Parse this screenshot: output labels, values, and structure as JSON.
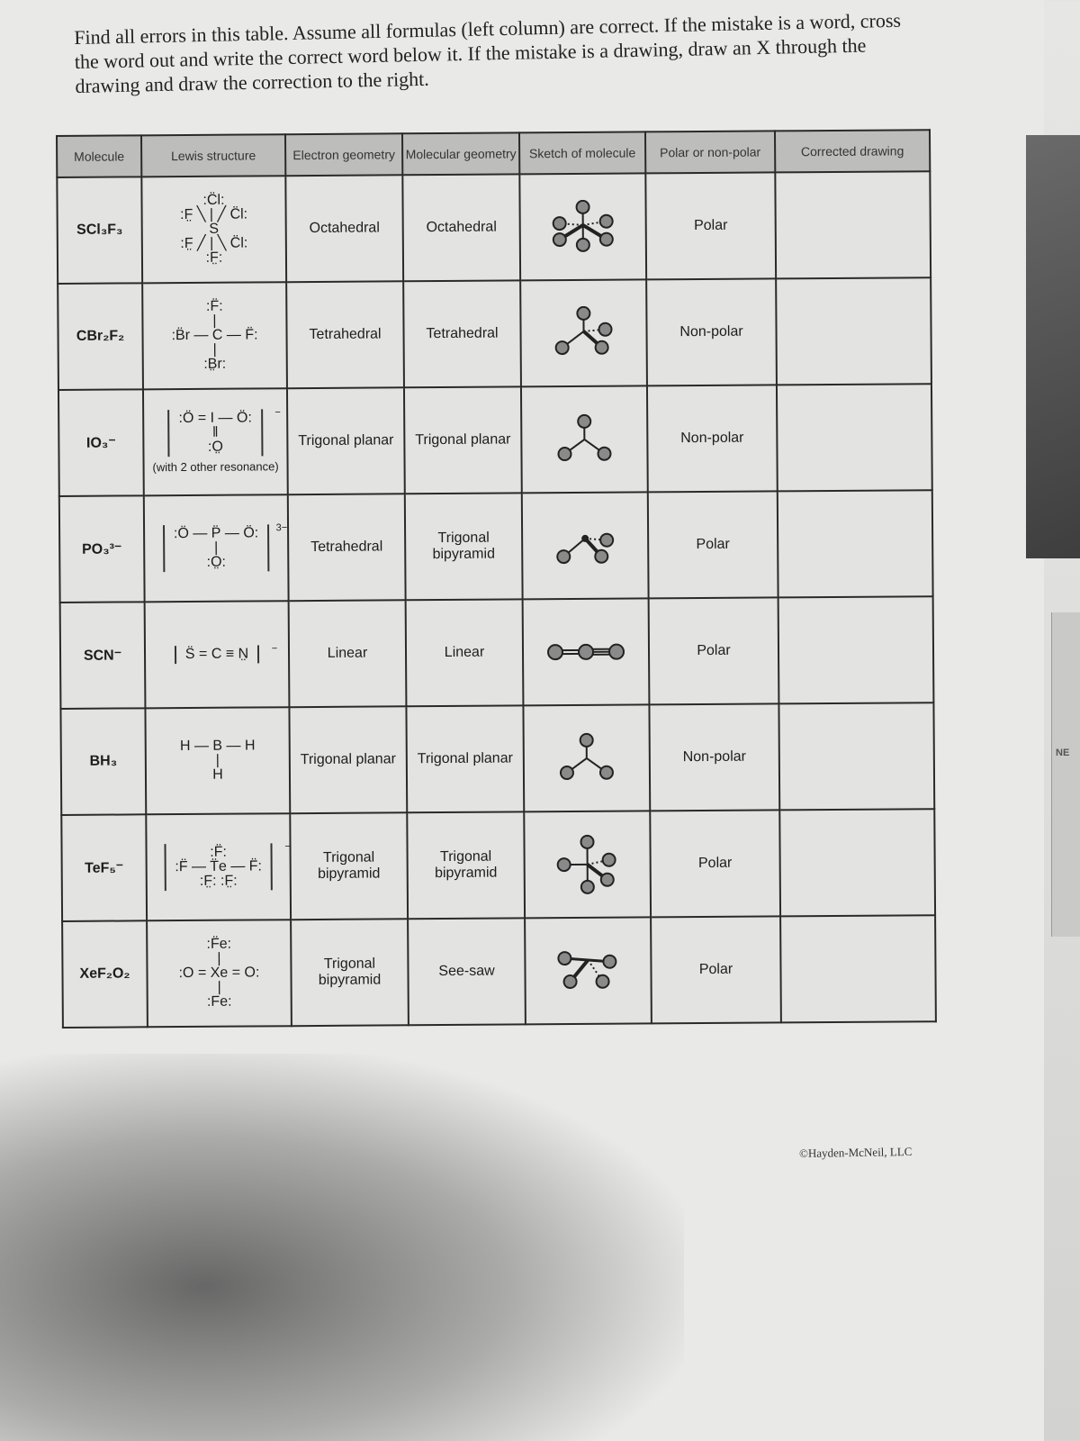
{
  "instructions": "Find all errors in this table. Assume all formulas (left column) are correct. If the mistake is a word, cross the word out and write the correct word below it. If the mistake is a drawing, draw an X through the drawing and draw the correction to the right.",
  "table": {
    "headers": [
      "Molecule",
      "Lewis structure",
      "Electron geometry",
      "Molecular geometry",
      "Sketch of molecule",
      "Polar or non-polar",
      "Corrected drawing"
    ],
    "rows": [
      {
        "molecule": "SCl₃F₃",
        "lewis": ":Cl: / :F—S—Cl: / :F—  —Cl: / :F:",
        "lewis_lines": [
          ":C̈l:",
          ":F̤ ╲ | ╱ C̈l:",
          "S",
          ":F̤ ╱ | ╲ C̈l:",
          ":F̤:"
        ],
        "lewis_note": "",
        "charge": "",
        "electron_geometry": "Octahedral",
        "molecular_geometry": "Octahedral",
        "sketch_icon": "octahedral-sketch-icon",
        "polarity": "Polar",
        "corrected": ""
      },
      {
        "molecule": "CBr₂F₂",
        "lewis_lines": [
          ":F̈:",
          "|",
          ":B̈r — C — F̈:",
          "|",
          ":B̤r:"
        ],
        "lewis_note": "",
        "charge": "",
        "electron_geometry": "Tetrahedral",
        "molecular_geometry": "Tetrahedral",
        "sketch_icon": "tetrahedral-sketch-icon",
        "polarity": "Non-polar",
        "corrected": ""
      },
      {
        "molecule": "IO₃⁻",
        "lewis_lines": [
          ":Ö = I — Ö:",
          "‖",
          ":O̤"
        ],
        "lewis_note": "(with 2 other resonance)",
        "charge": "−",
        "electron_geometry": "Trigonal planar",
        "molecular_geometry": "Trigonal planar",
        "sketch_icon": "trigonal-planar-sketch-icon",
        "polarity": "Non-polar",
        "corrected": ""
      },
      {
        "molecule": "PO₃³⁻",
        "lewis_lines": [
          ":Ö — P̈ — Ö:",
          "|",
          ":O̤:"
        ],
        "lewis_note": "",
        "charge": "3−",
        "electron_geometry": "Tetrahedral",
        "molecular_geometry": "Trigonal bipyramid",
        "sketch_icon": "trigonal-pyramidal-sketch-icon",
        "polarity": "Polar",
        "corrected": ""
      },
      {
        "molecule": "SCN⁻",
        "lewis_lines": [
          "S̈ = C ≡ N̤"
        ],
        "lewis_note": "",
        "charge": "−",
        "electron_geometry": "Linear",
        "molecular_geometry": "Linear",
        "sketch_icon": "linear-sketch-icon",
        "polarity": "Polar",
        "corrected": ""
      },
      {
        "molecule": "BH₃",
        "lewis_lines": [
          "H — B — H",
          "|",
          "H"
        ],
        "lewis_note": "",
        "charge": "",
        "electron_geometry": "Trigonal planar",
        "molecular_geometry": "Trigonal planar",
        "sketch_icon": "trigonal-planar-sketch-icon",
        "polarity": "Non-polar",
        "corrected": ""
      },
      {
        "molecule": "TeF₅⁻",
        "lewis_lines": [
          ":F̈:",
          ":F̈ — T̈e — F̈:",
          ":F̤: :F̤:"
        ],
        "lewis_note": "",
        "charge": "−",
        "electron_geometry": "Trigonal bipyramid",
        "molecular_geometry": "Trigonal bipyramid",
        "sketch_icon": "trigonal-bipyramid-sketch-icon",
        "polarity": "Polar",
        "corrected": ""
      },
      {
        "molecule": "XeF₂O₂",
        "lewis_lines": [
          ":F̈e:",
          "|",
          ":O = Xe = O:",
          "|",
          ":Fe:"
        ],
        "lewis_note": "",
        "charge": "",
        "electron_geometry": "Trigonal bipyramid",
        "molecular_geometry": "See-saw",
        "sketch_icon": "see-saw-sketch-icon",
        "polarity": "Polar",
        "corrected": ""
      }
    ]
  },
  "credit": "©Hayden-McNeil, LLC",
  "side_fragment_text": "NE",
  "colors": {
    "paper": "#e9e9e7",
    "header_fill": "#bdbdbb",
    "ink": "#1d1d1d",
    "atom": "#8a8a8a"
  }
}
